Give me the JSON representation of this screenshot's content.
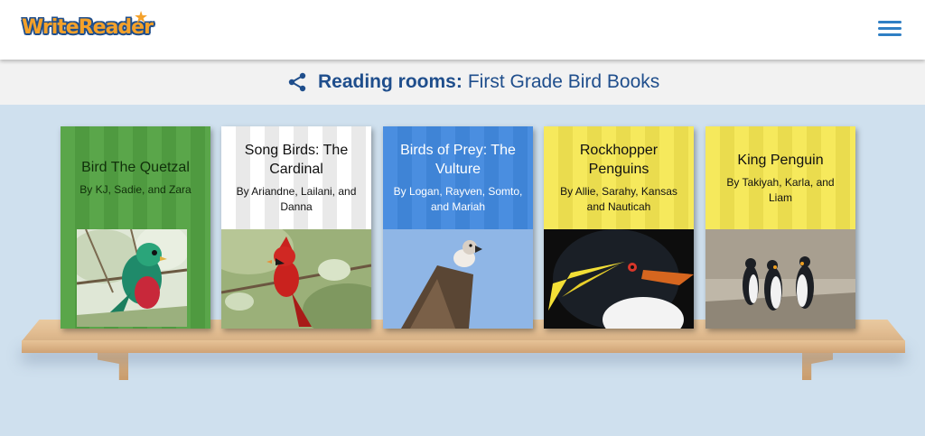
{
  "header": {
    "logo_text": "WriteReader",
    "logo_star": "★",
    "menu_icon": "hamburger-menu-icon"
  },
  "titlebar": {
    "share_icon": "share-icon",
    "prefix": "Reading rooms:",
    "room_name": "First Grade Bird Books"
  },
  "books": [
    {
      "title": "Bird The Quetzal",
      "authors": "By KJ, Sadie, and Zara",
      "cover_color": "#5aa64a"
    },
    {
      "title": "Song Birds: The Cardinal",
      "authors": "By Ariandne, Lailani, and Danna",
      "cover_color": "#ffffff"
    },
    {
      "title": "Birds of Prey: The Vulture",
      "authors": "By Logan, Rayven, Somto, and Mariah",
      "cover_color": "#4a8ee0"
    },
    {
      "title": "Rockhopper Penguins",
      "authors": "By Allie, Sarahy, Kansas and Nauticah",
      "cover_color": "#f6e95c"
    },
    {
      "title": "King Penguin",
      "authors": "By Takiyah, Karla, and Liam",
      "cover_color": "#f6e95c"
    }
  ],
  "colors": {
    "brand_orange": "#f4a12a",
    "brand_blue": "#1f4e8c",
    "menu_blue": "#2f7fc4",
    "background": "#cfe0ee"
  }
}
